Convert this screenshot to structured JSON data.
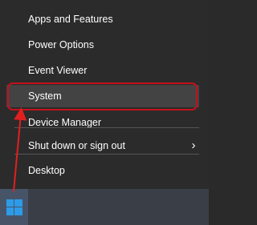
{
  "menu": {
    "items": [
      {
        "label": "Apps and Features"
      },
      {
        "label": "Power Options"
      },
      {
        "label": "Event Viewer"
      },
      {
        "label": "System"
      },
      {
        "label": "Device Manager"
      },
      {
        "label": "Shut down or sign out"
      },
      {
        "label": "Desktop"
      }
    ],
    "submenu_icon": "chevron-right-icon"
  },
  "taskbar": {
    "start_icon": "windows-logo-icon"
  },
  "colors": {
    "menu_background": "#2b2b2b",
    "hover_background": "#434343",
    "highlight_border": "#c4111b",
    "taskbar": "#3a3e46",
    "start_button": "#475468",
    "windows_logo": "#2d9ce8"
  }
}
